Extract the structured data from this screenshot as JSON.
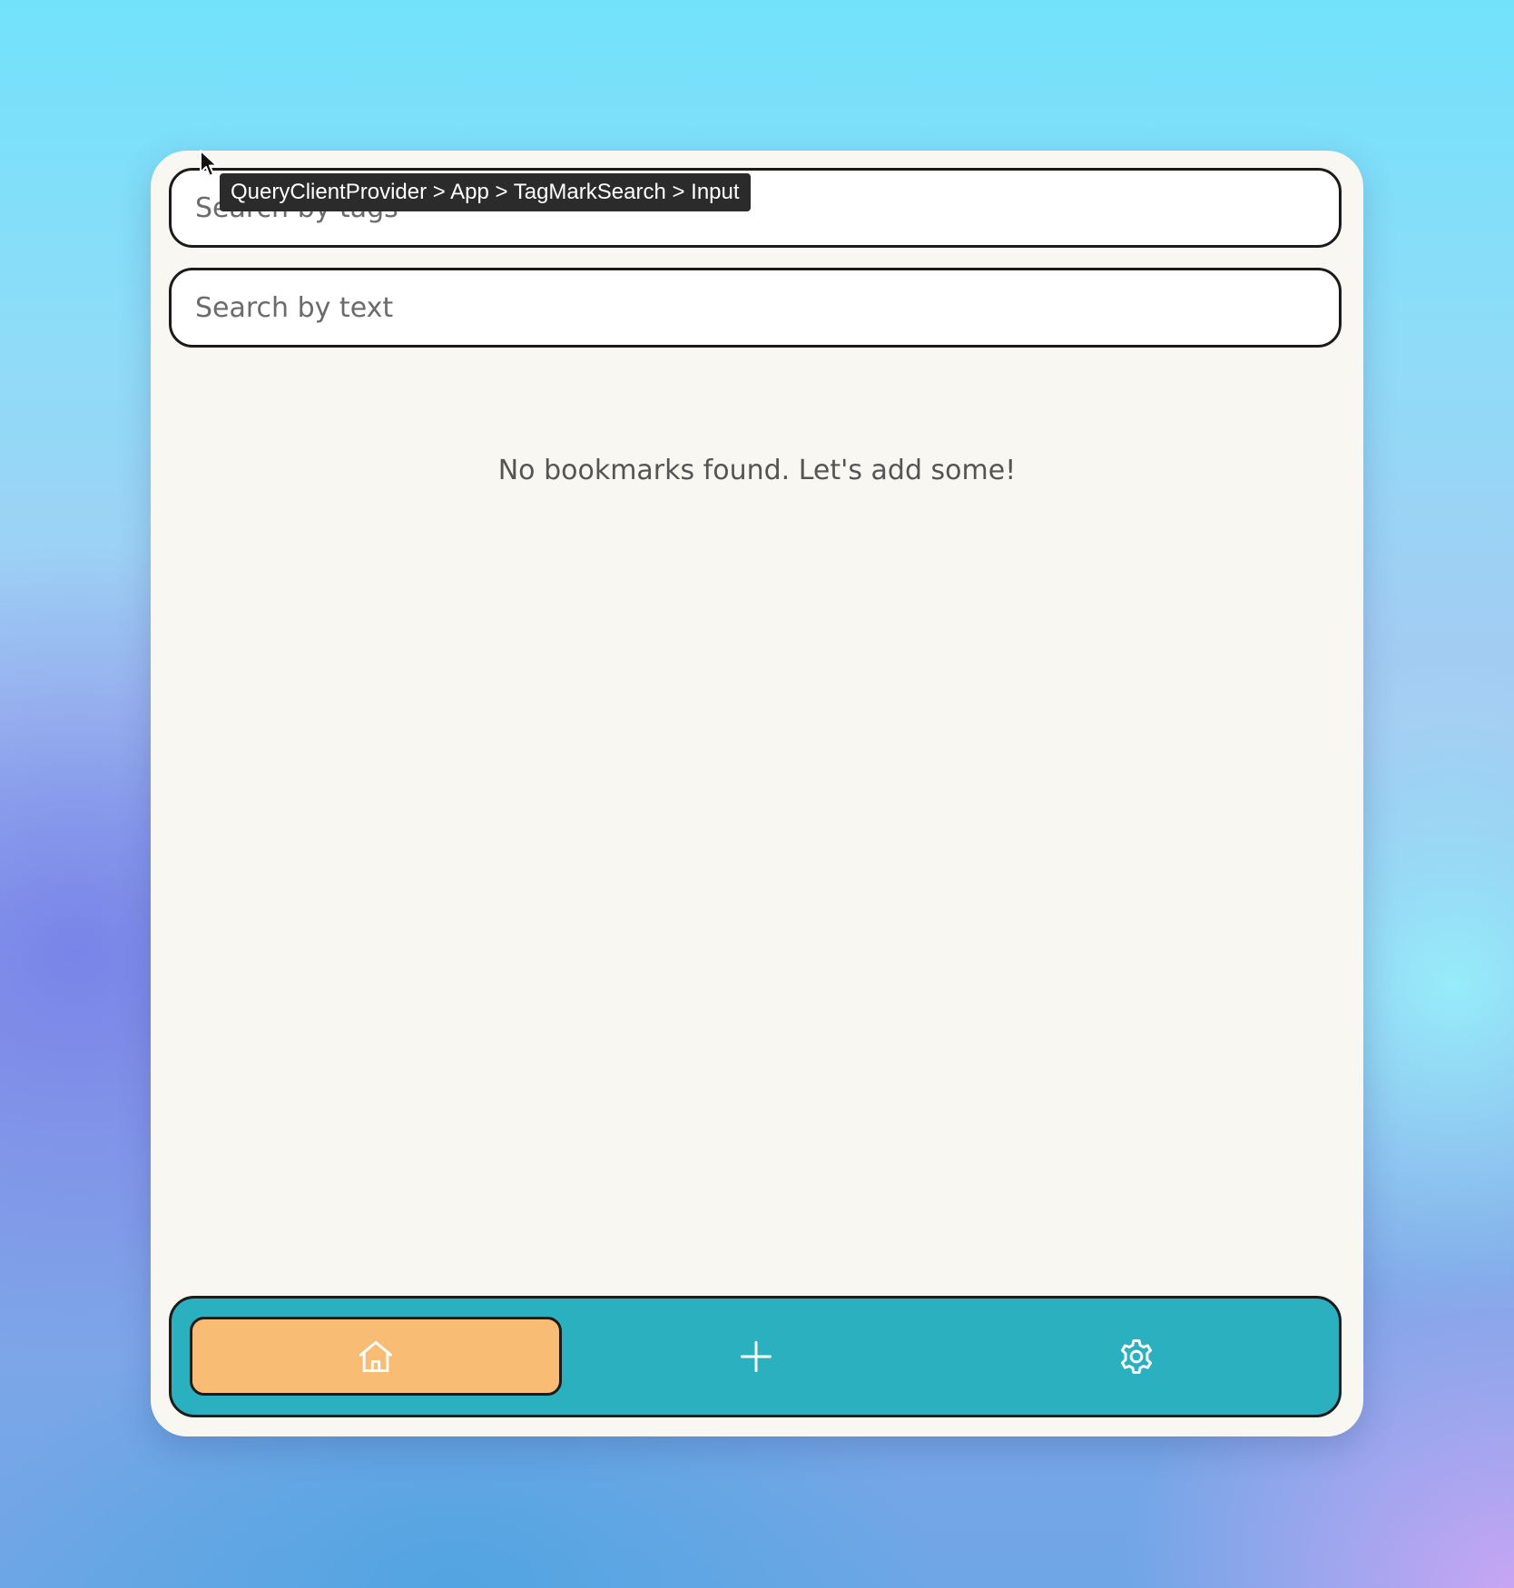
{
  "search": {
    "tags_placeholder": "Search by tags",
    "text_placeholder": "Search by text"
  },
  "tooltip": {
    "text": "QueryClientProvider > App > TagMarkSearch > Input"
  },
  "main": {
    "empty_message": "No bookmarks found. Let's add some!"
  },
  "nav": {
    "items": [
      {
        "icon": "home-icon",
        "active": true
      },
      {
        "icon": "plus-icon",
        "active": false
      },
      {
        "icon": "gear-icon",
        "active": false
      }
    ]
  },
  "colors": {
    "panel_background": "#f8f7f2",
    "nav_background": "#2ab0bf",
    "active_nav_item": "#f9bc74",
    "border": "#1b1b1b"
  }
}
